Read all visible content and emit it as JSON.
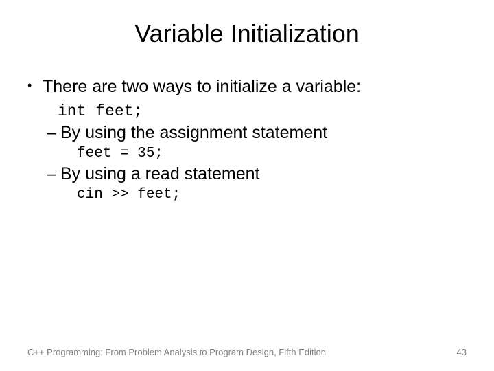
{
  "title": "Variable Initialization",
  "bullet_char": "•",
  "intro": "There are two ways to initialize a variable:",
  "code_decl": "int feet;",
  "sub1": "By using the assignment statement",
  "code_assign": "feet = 35;",
  "sub2": "By using a read statement",
  "code_read": "cin >> feet;",
  "footer_text": "C++ Programming: From Problem Analysis to Program Design, Fifth Edition",
  "page_number": "43"
}
